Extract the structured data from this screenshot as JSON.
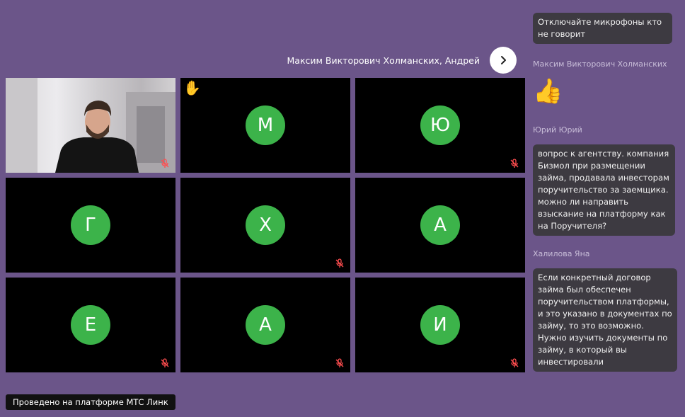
{
  "header": {
    "speaker_names": "Максим Викторович Холманских, Андрей"
  },
  "participants": [
    {
      "type": "video"
    },
    {
      "type": "avatar",
      "initial": "М",
      "hand_raised": true
    },
    {
      "type": "avatar",
      "initial": "Ю"
    },
    {
      "type": "avatar",
      "initial": "Г"
    },
    {
      "type": "avatar",
      "initial": "Х"
    },
    {
      "type": "avatar",
      "initial": "А"
    },
    {
      "type": "avatar",
      "initial": "Е"
    },
    {
      "type": "avatar",
      "initial": "А"
    },
    {
      "type": "avatar",
      "initial": "И"
    }
  ],
  "chat": {
    "msg1": "Отключайте микрофоны кто не говорит",
    "author2": "Максим Викторович Холманских",
    "msg2_emoji": "👍",
    "author3": "Юрий Юрий",
    "msg3": "вопрос к агентству. компания Бизмол при размещении займа, продавала инвесторам поручительство за заемщика. можно ли направить взыскание на платформу как на Поручителя?",
    "author4": "Халилова Яна",
    "msg4": "Если конкретный договор займа был обеспечен поручительством платформы, и это указано в документах по займу, то это возможно. Нужно изучить документы по займу, в который вы инвестировали"
  },
  "footer": {
    "badge": "Проведено на платформе МТС Линк"
  },
  "colors": {
    "background": "#6b5589",
    "avatar": "#3cb34a",
    "bubble": "#3d3a41",
    "mic_off": "#ff4d4f"
  }
}
